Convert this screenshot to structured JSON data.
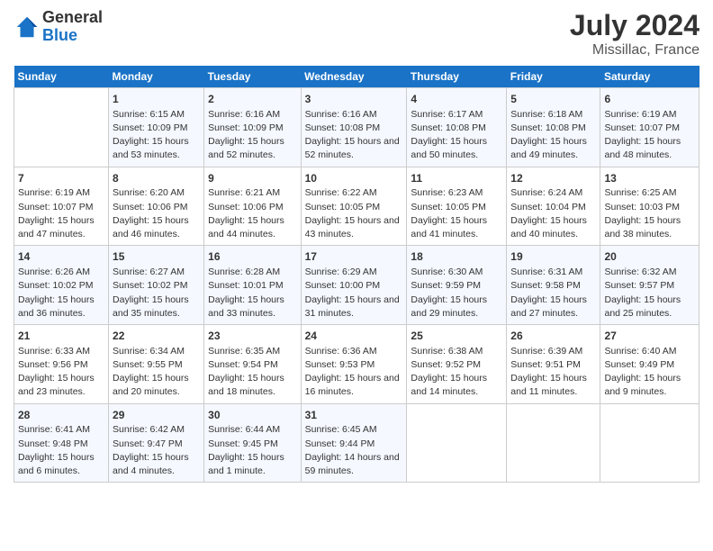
{
  "logo": {
    "general": "General",
    "blue": "Blue"
  },
  "title": "July 2024",
  "subtitle": "Missillac, France",
  "headers": [
    "Sunday",
    "Monday",
    "Tuesday",
    "Wednesday",
    "Thursday",
    "Friday",
    "Saturday"
  ],
  "weeks": [
    [
      {
        "day": "",
        "sunrise": "",
        "sunset": "",
        "daylight": ""
      },
      {
        "day": "1",
        "sunrise": "Sunrise: 6:15 AM",
        "sunset": "Sunset: 10:09 PM",
        "daylight": "Daylight: 15 hours and 53 minutes."
      },
      {
        "day": "2",
        "sunrise": "Sunrise: 6:16 AM",
        "sunset": "Sunset: 10:09 PM",
        "daylight": "Daylight: 15 hours and 52 minutes."
      },
      {
        "day": "3",
        "sunrise": "Sunrise: 6:16 AM",
        "sunset": "Sunset: 10:08 PM",
        "daylight": "Daylight: 15 hours and 52 minutes."
      },
      {
        "day": "4",
        "sunrise": "Sunrise: 6:17 AM",
        "sunset": "Sunset: 10:08 PM",
        "daylight": "Daylight: 15 hours and 50 minutes."
      },
      {
        "day": "5",
        "sunrise": "Sunrise: 6:18 AM",
        "sunset": "Sunset: 10:08 PM",
        "daylight": "Daylight: 15 hours and 49 minutes."
      },
      {
        "day": "6",
        "sunrise": "Sunrise: 6:19 AM",
        "sunset": "Sunset: 10:07 PM",
        "daylight": "Daylight: 15 hours and 48 minutes."
      }
    ],
    [
      {
        "day": "7",
        "sunrise": "Sunrise: 6:19 AM",
        "sunset": "Sunset: 10:07 PM",
        "daylight": "Daylight: 15 hours and 47 minutes."
      },
      {
        "day": "8",
        "sunrise": "Sunrise: 6:20 AM",
        "sunset": "Sunset: 10:06 PM",
        "daylight": "Daylight: 15 hours and 46 minutes."
      },
      {
        "day": "9",
        "sunrise": "Sunrise: 6:21 AM",
        "sunset": "Sunset: 10:06 PM",
        "daylight": "Daylight: 15 hours and 44 minutes."
      },
      {
        "day": "10",
        "sunrise": "Sunrise: 6:22 AM",
        "sunset": "Sunset: 10:05 PM",
        "daylight": "Daylight: 15 hours and 43 minutes."
      },
      {
        "day": "11",
        "sunrise": "Sunrise: 6:23 AM",
        "sunset": "Sunset: 10:05 PM",
        "daylight": "Daylight: 15 hours and 41 minutes."
      },
      {
        "day": "12",
        "sunrise": "Sunrise: 6:24 AM",
        "sunset": "Sunset: 10:04 PM",
        "daylight": "Daylight: 15 hours and 40 minutes."
      },
      {
        "day": "13",
        "sunrise": "Sunrise: 6:25 AM",
        "sunset": "Sunset: 10:03 PM",
        "daylight": "Daylight: 15 hours and 38 minutes."
      }
    ],
    [
      {
        "day": "14",
        "sunrise": "Sunrise: 6:26 AM",
        "sunset": "Sunset: 10:02 PM",
        "daylight": "Daylight: 15 hours and 36 minutes."
      },
      {
        "day": "15",
        "sunrise": "Sunrise: 6:27 AM",
        "sunset": "Sunset: 10:02 PM",
        "daylight": "Daylight: 15 hours and 35 minutes."
      },
      {
        "day": "16",
        "sunrise": "Sunrise: 6:28 AM",
        "sunset": "Sunset: 10:01 PM",
        "daylight": "Daylight: 15 hours and 33 minutes."
      },
      {
        "day": "17",
        "sunrise": "Sunrise: 6:29 AM",
        "sunset": "Sunset: 10:00 PM",
        "daylight": "Daylight: 15 hours and 31 minutes."
      },
      {
        "day": "18",
        "sunrise": "Sunrise: 6:30 AM",
        "sunset": "Sunset: 9:59 PM",
        "daylight": "Daylight: 15 hours and 29 minutes."
      },
      {
        "day": "19",
        "sunrise": "Sunrise: 6:31 AM",
        "sunset": "Sunset: 9:58 PM",
        "daylight": "Daylight: 15 hours and 27 minutes."
      },
      {
        "day": "20",
        "sunrise": "Sunrise: 6:32 AM",
        "sunset": "Sunset: 9:57 PM",
        "daylight": "Daylight: 15 hours and 25 minutes."
      }
    ],
    [
      {
        "day": "21",
        "sunrise": "Sunrise: 6:33 AM",
        "sunset": "Sunset: 9:56 PM",
        "daylight": "Daylight: 15 hours and 23 minutes."
      },
      {
        "day": "22",
        "sunrise": "Sunrise: 6:34 AM",
        "sunset": "Sunset: 9:55 PM",
        "daylight": "Daylight: 15 hours and 20 minutes."
      },
      {
        "day": "23",
        "sunrise": "Sunrise: 6:35 AM",
        "sunset": "Sunset: 9:54 PM",
        "daylight": "Daylight: 15 hours and 18 minutes."
      },
      {
        "day": "24",
        "sunrise": "Sunrise: 6:36 AM",
        "sunset": "Sunset: 9:53 PM",
        "daylight": "Daylight: 15 hours and 16 minutes."
      },
      {
        "day": "25",
        "sunrise": "Sunrise: 6:38 AM",
        "sunset": "Sunset: 9:52 PM",
        "daylight": "Daylight: 15 hours and 14 minutes."
      },
      {
        "day": "26",
        "sunrise": "Sunrise: 6:39 AM",
        "sunset": "Sunset: 9:51 PM",
        "daylight": "Daylight: 15 hours and 11 minutes."
      },
      {
        "day": "27",
        "sunrise": "Sunrise: 6:40 AM",
        "sunset": "Sunset: 9:49 PM",
        "daylight": "Daylight: 15 hours and 9 minutes."
      }
    ],
    [
      {
        "day": "28",
        "sunrise": "Sunrise: 6:41 AM",
        "sunset": "Sunset: 9:48 PM",
        "daylight": "Daylight: 15 hours and 6 minutes."
      },
      {
        "day": "29",
        "sunrise": "Sunrise: 6:42 AM",
        "sunset": "Sunset: 9:47 PM",
        "daylight": "Daylight: 15 hours and 4 minutes."
      },
      {
        "day": "30",
        "sunrise": "Sunrise: 6:44 AM",
        "sunset": "Sunset: 9:45 PM",
        "daylight": "Daylight: 15 hours and 1 minute."
      },
      {
        "day": "31",
        "sunrise": "Sunrise: 6:45 AM",
        "sunset": "Sunset: 9:44 PM",
        "daylight": "Daylight: 14 hours and 59 minutes."
      },
      {
        "day": "",
        "sunrise": "",
        "sunset": "",
        "daylight": ""
      },
      {
        "day": "",
        "sunrise": "",
        "sunset": "",
        "daylight": ""
      },
      {
        "day": "",
        "sunrise": "",
        "sunset": "",
        "daylight": ""
      }
    ]
  ]
}
